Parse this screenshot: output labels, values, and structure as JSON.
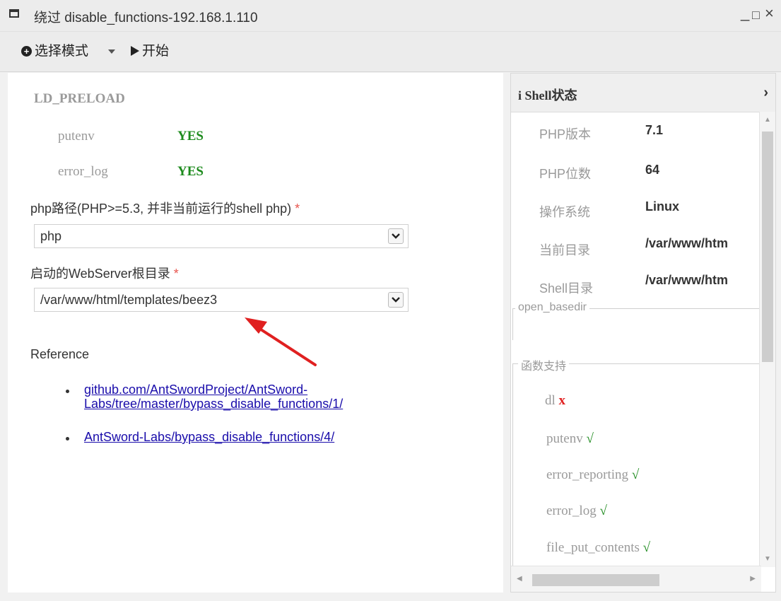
{
  "window": {
    "title": "绕过 disable_functions-192.168.1.110",
    "minimize": "_",
    "maximize": "□",
    "close": "×"
  },
  "toolbar": {
    "mode_label": "选择模式",
    "start_label": "开始"
  },
  "left": {
    "section_title": "LD_PRELOAD",
    "checks": [
      {
        "name": "putenv",
        "value": "YES"
      },
      {
        "name": "error_log",
        "value": "YES"
      }
    ],
    "php_path": {
      "label": "php路径(PHP>=5.3, 并非当前运行的shell php)",
      "required_mark": "*",
      "value": "php"
    },
    "webroot": {
      "label": "启动的WebServer根目录",
      "required_mark": "*",
      "value": "/var/www/html/templates/beez3"
    },
    "reference": {
      "title": "Reference",
      "links": [
        {
          "line1": "github.com/AntSwordProject/AntSword-",
          "line2": "Labs/tree/master/bypass_disable_functions/1/"
        },
        {
          "line1": "AntSword-Labs/bypass_disable_functions/4/",
          "line2": ""
        }
      ]
    }
  },
  "right": {
    "header": "Shell状态",
    "info_icon": "i",
    "chevron": "›",
    "info": [
      {
        "key": "PHP版本",
        "value": "7.1"
      },
      {
        "key": "PHP位数",
        "value": "64"
      },
      {
        "key": "操作系统",
        "value": "Linux"
      },
      {
        "key": "当前目录",
        "value": "/var/www/htm"
      },
      {
        "key": "Shell目录",
        "value": "/var/www/htm"
      }
    ],
    "open_basedir_legend": "open_basedir",
    "func_legend": "函数支持",
    "functions": [
      {
        "name": "dl",
        "status": "x"
      },
      {
        "name": "putenv",
        "status": "√"
      },
      {
        "name": "error_reporting",
        "status": "√"
      },
      {
        "name": "error_log",
        "status": "√"
      },
      {
        "name": "file_put_contents",
        "status": "√"
      }
    ]
  },
  "colors": {
    "ok": "#1e8b1e",
    "bad": "#e02020",
    "required": "#e8554e",
    "annotation_arrow": "#e02020"
  }
}
